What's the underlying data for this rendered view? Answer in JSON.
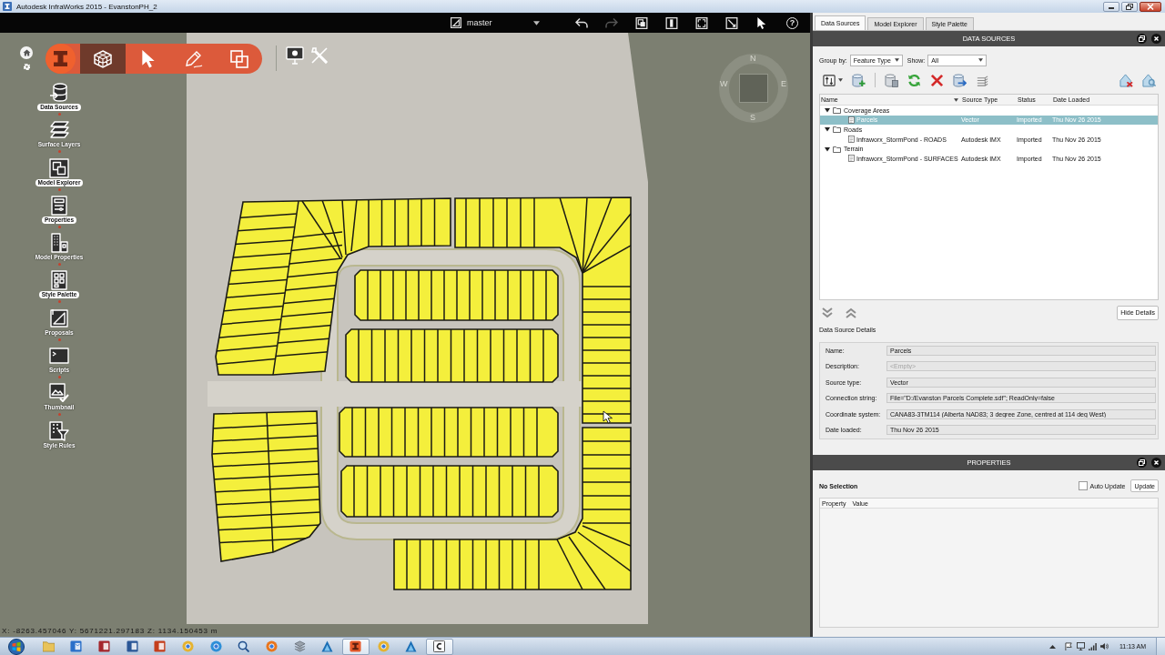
{
  "window": {
    "title": "Autodesk InfraWorks 2015 - EvanstonPH_2"
  },
  "view_bar": {
    "proposal": "master",
    "history": [
      {
        "disabled": false
      },
      {
        "disabled": true
      }
    ],
    "help": "?"
  },
  "mode_tools": [
    {
      "selected": true
    },
    {
      "selected": false
    },
    {
      "selected": false
    },
    {
      "selected": false
    }
  ],
  "sidebar": {
    "items": [
      {
        "label": "Data Sources",
        "open": true
      },
      {
        "label": "Surface Layers",
        "open": false
      },
      {
        "label": "Model Explorer",
        "open": true
      },
      {
        "label": "Properties",
        "open": true
      },
      {
        "label": "Model Properties",
        "open": false
      },
      {
        "label": "Style Palette",
        "open": true
      },
      {
        "label": "Proposals",
        "open": false
      },
      {
        "label": "Scripts",
        "open": false
      },
      {
        "label": "Thumbnail",
        "open": false
      },
      {
        "label": "Style Rules",
        "open": false
      }
    ]
  },
  "compass": {
    "north": "N",
    "east": "E",
    "south": "S",
    "west": "W"
  },
  "status_bar": {
    "coordinates": "X: -8263.457046 Y: 5671221.297183 Z: 1134.150453 m"
  },
  "panel_tabs": [
    {
      "label": "Data Sources",
      "selected": true
    },
    {
      "label": "Model Explorer",
      "selected": false
    },
    {
      "label": "Style Palette",
      "selected": false
    }
  ],
  "data_sources": {
    "title": "DATA SOURCES",
    "group_by": {
      "label": "Group by:",
      "value": "Feature Type"
    },
    "show": {
      "label": "Show:",
      "value": "All"
    },
    "table": {
      "columns": [
        "Name",
        "Source Type",
        "Status",
        "Date Loaded"
      ],
      "groups": [
        {
          "name": "Coverage Areas",
          "expanded": true,
          "selected": false,
          "children": [
            {
              "name": "Parcels",
              "source_type": "Vector",
              "status": "Imported",
              "date_loaded": "Thu Nov 26 2015",
              "selected": true
            }
          ]
        },
        {
          "name": "Roads",
          "expanded": true,
          "selected": false,
          "children": [
            {
              "name": "Infraworx_StormPond - ROADS",
              "source_type": "Autodesk IMX",
              "status": "Imported",
              "date_loaded": "Thu Nov 26 2015",
              "selected": false
            }
          ]
        },
        {
          "name": "Terrain",
          "expanded": true,
          "selected": false,
          "children": [
            {
              "name": "Infraworx_StormPond - SURFACES",
              "source_type": "Autodesk IMX",
              "status": "Imported",
              "date_loaded": "Thu Nov 26 2015",
              "selected": false
            }
          ]
        }
      ]
    },
    "hide_details": "Hide Details",
    "details_title": "Data Source Details",
    "details": [
      {
        "label": "Name:",
        "value": "Parcels"
      },
      {
        "label": "Description:",
        "placeholder": "<Empty>"
      },
      {
        "label": "Source type:",
        "value": "Vector"
      },
      {
        "label": "Connection string:",
        "value": "File=\"D:/Evanston Parcels Complete.sdf\"; ReadOnly=false"
      },
      {
        "label": "Coordinate system:",
        "value": "CANA83-3TM114 (Alberta NAD83; 3 degree Zone, centred at 114 deg West)"
      },
      {
        "label": "Date loaded:",
        "value": "Thu Nov 26 2015"
      }
    ]
  },
  "properties": {
    "title": "PROPERTIES",
    "selection": "No Selection",
    "auto_update": {
      "label": "Auto Update",
      "checked": false
    },
    "update_button": "Update",
    "columns": [
      "Property",
      "Value"
    ]
  },
  "taskbar": {
    "apps": [
      {
        "active": false
      },
      {
        "active": false
      },
      {
        "active": false
      },
      {
        "active": false
      },
      {
        "active": false
      },
      {
        "active": false
      },
      {
        "active": false
      },
      {
        "active": false
      },
      {
        "active": false
      },
      {
        "active": false
      },
      {
        "active": false
      },
      {
        "active": true
      },
      {
        "active": false
      },
      {
        "active": false
      },
      {
        "active": true
      }
    ],
    "clock": "11:13 AM"
  }
}
